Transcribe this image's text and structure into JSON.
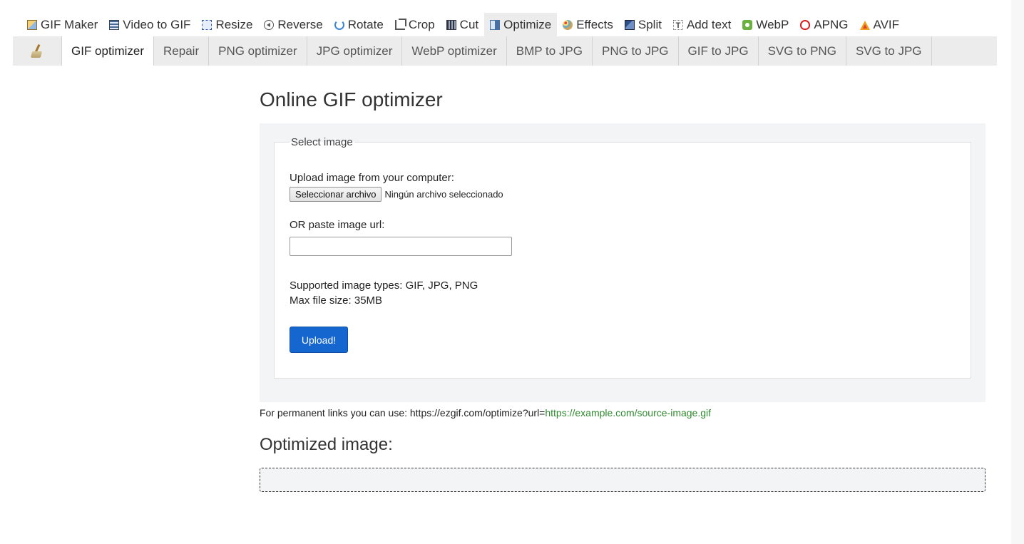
{
  "topnav": {
    "items": [
      {
        "label": "GIF Maker",
        "icon": "gif-maker-icon"
      },
      {
        "label": "Video to GIF",
        "icon": "film-icon"
      },
      {
        "label": "Resize",
        "icon": "resize-icon"
      },
      {
        "label": "Reverse",
        "icon": "reverse-icon"
      },
      {
        "label": "Rotate",
        "icon": "rotate-icon"
      },
      {
        "label": "Crop",
        "icon": "crop-icon"
      },
      {
        "label": "Cut",
        "icon": "cut-icon"
      },
      {
        "label": "Optimize",
        "icon": "optimize-icon",
        "active": true
      },
      {
        "label": "Effects",
        "icon": "palette-icon"
      },
      {
        "label": "Split",
        "icon": "split-icon"
      },
      {
        "label": "Add text",
        "icon": "add-text-icon"
      },
      {
        "label": "WebP",
        "icon": "webp-icon"
      },
      {
        "label": "APNG",
        "icon": "apng-icon"
      },
      {
        "label": "AVIF",
        "icon": "avif-icon"
      }
    ]
  },
  "subnav": {
    "logo_icon": "broom-icon",
    "tabs": [
      {
        "label": "GIF optimizer",
        "active": true
      },
      {
        "label": "Repair"
      },
      {
        "label": "PNG optimizer"
      },
      {
        "label": "JPG optimizer"
      },
      {
        "label": "WebP optimizer"
      },
      {
        "label": "BMP to JPG"
      },
      {
        "label": "PNG to JPG"
      },
      {
        "label": "GIF to JPG"
      },
      {
        "label": "SVG to PNG"
      },
      {
        "label": "SVG to JPG"
      }
    ]
  },
  "main": {
    "title": "Online GIF optimizer",
    "form": {
      "legend": "Select image",
      "upload_label": "Upload image from your computer:",
      "file_button": "Seleccionar archivo",
      "file_status": "Ningún archivo seleccionado",
      "url_label": "OR paste image url:",
      "url_value": "",
      "types_line": "Supported image types: GIF, JPG, PNG",
      "max_size_line": "Max file size: 35MB",
      "upload_button": "Upload!"
    },
    "permalink_prefix": "For permanent links you can use: https://ezgif.com/optimize?url=",
    "permalink_example": "https://example.com/source-image.gif",
    "result_title": "Optimized image:"
  },
  "colors": {
    "accent_button": "#1666d0",
    "link_example": "#2f8a2f",
    "nav_bg": "#ececec"
  }
}
